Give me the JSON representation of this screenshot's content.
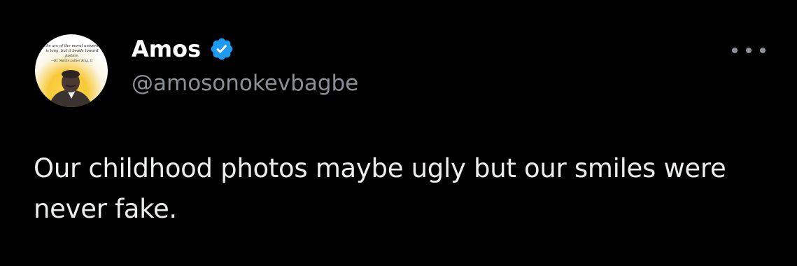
{
  "tweet": {
    "author": {
      "display_name": "Amos",
      "handle": "@amosonokevbagbe",
      "verified": true,
      "verified_icon": "verified-badge-icon",
      "avatar_quote": "The arc of the moral universe is long, but it bends toward justice.",
      "avatar_attribution": "—Dr. Martin Luther King, Jr."
    },
    "more_icon": "more-horizontal-icon",
    "text": "Our childhood photos maybe ugly but our smiles were never fake."
  },
  "colors": {
    "background": "#000000",
    "name": "#ffffff",
    "handle": "#8b9096",
    "body_text": "#ecedee",
    "verified_badge": "#1d9bf0"
  }
}
